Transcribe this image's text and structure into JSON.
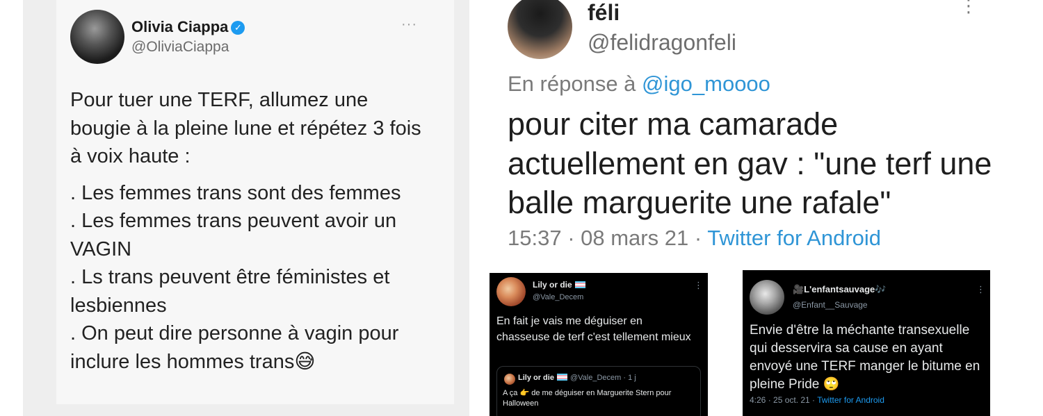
{
  "tweet_olivia": {
    "display_name": "Olivia Ciappa",
    "handle": "@OliviaCiappa",
    "verified_mark": "✓",
    "more": "···",
    "text_intro": "Pour tuer une TERF, allumez une bougie à la pleine lune et répétez 3 fois à voix haute :",
    "points": [
      ". Les femmes trans sont des femmes",
      ". Les femmes trans peuvent avoir un VAGIN",
      ". Ls trans peuvent être féministes et lesbiennes",
      ". On peut dire personne à vagin pour inclure les hommes trans😅"
    ]
  },
  "tweet_feli": {
    "display_name": "féli",
    "handle": "@felidragonfeli",
    "more": "⋮",
    "reply_prefix": "En réponse à",
    "reply_mention": "@igo_moooo",
    "text": "pour citer ma camarade actuellement en gav : \"une terf une balle marguerite une rafale\"",
    "timestamp": "15:37 · 08 mars 21 ·",
    "source": "Twitter for Android"
  },
  "tweet_lily": {
    "display_name": "Lily or die",
    "handle": "@Vale_Decem",
    "more": "⋮",
    "text": "En fait je vais me déguiser en chasseuse de terf c'est tellement mieux",
    "quote": {
      "display_name": "Lily or die",
      "handle_time": "@Vale_Decem · 1 j",
      "text": "A ça 👉 de me déguiser en Marguerite Stern pour Halloween"
    }
  },
  "tweet_enfant": {
    "display_name": "🎥L'enfantsauvage🎶",
    "handle": "@Enfant__Sauvage",
    "more": "⋮",
    "text": "Envie d'être la méchante transexuelle qui desservira sa cause en ayant envoyé une TERF manger le bitume en pleine Pride 🙄",
    "timestamp": "4:26 · 25 oct. 21 ·",
    "source": "Twitter for Android"
  }
}
